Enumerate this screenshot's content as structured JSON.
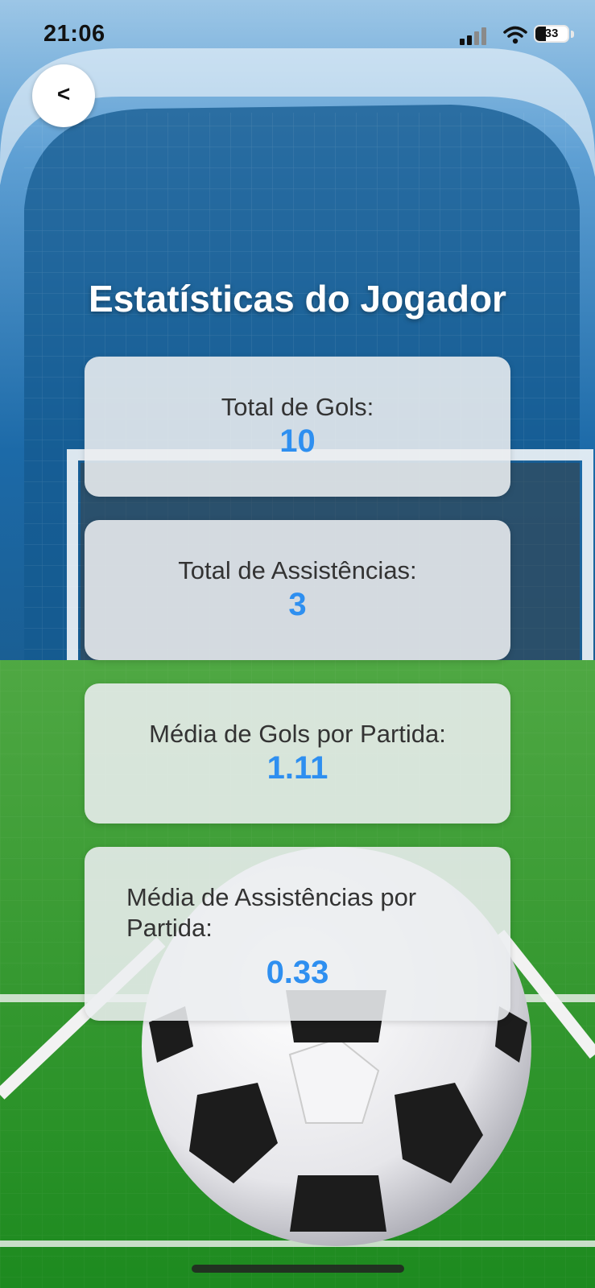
{
  "status_bar": {
    "time": "21:06",
    "battery": "33",
    "battery_level_percent": 33,
    "icons": [
      "signal-icon",
      "wifi-icon",
      "battery-icon"
    ]
  },
  "header": {
    "back_label": "<",
    "title": "Estatísticas do Jogador"
  },
  "stats": [
    {
      "label": "Total de Gols:",
      "value": "10"
    },
    {
      "label": "Total de Assistências:",
      "value": "3"
    },
    {
      "label": "Média de Gols por Partida:",
      "value": "1.11"
    },
    {
      "label": "Média de Assistências por Partida:",
      "value": "0.33"
    }
  ],
  "colors": {
    "accent": "#2e8ff0",
    "card_background": "#eceef0",
    "title": "#ffffff",
    "sky": "#1f6aa8",
    "grass": "#2f9a2a"
  },
  "background": {
    "scene": "soccer goal and ball on green pitch"
  }
}
